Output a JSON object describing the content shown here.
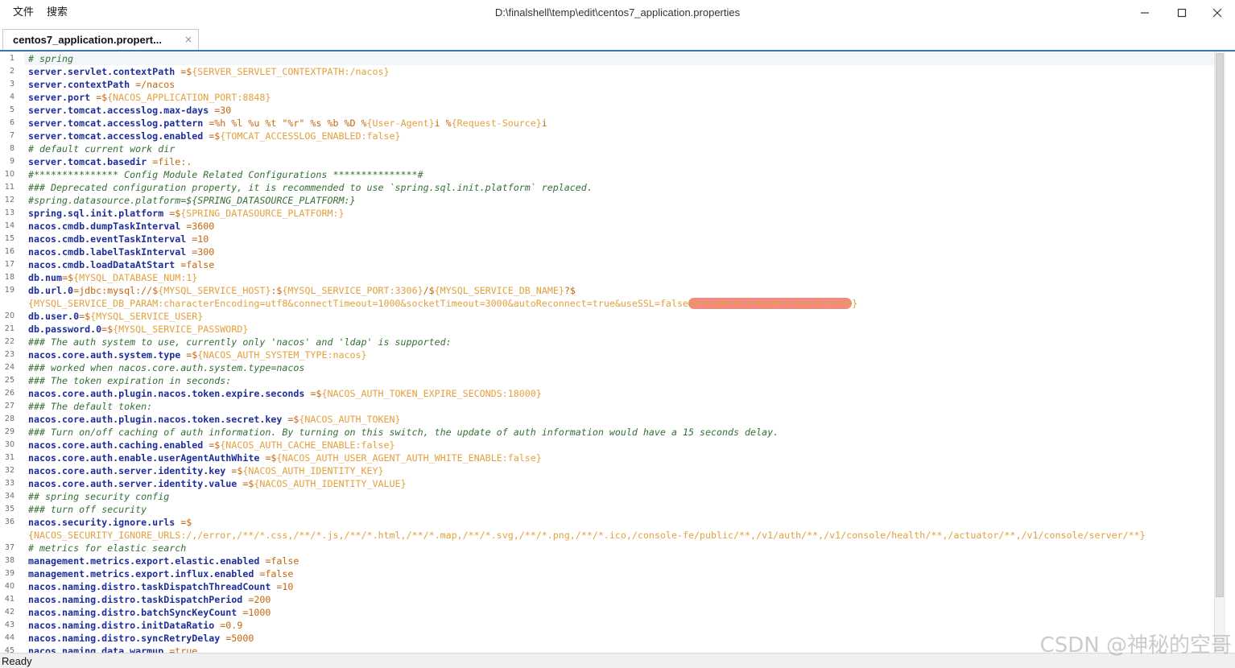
{
  "window": {
    "menu": [
      {
        "label": "文件"
      },
      {
        "label": "搜索"
      }
    ],
    "title": "D:\\finalshell\\temp\\edit\\centos7_application.properties",
    "icons": {
      "minimize": "minimize-icon",
      "maximize": "maximize-icon",
      "close": "close-icon"
    }
  },
  "tabs": [
    {
      "label": "centos7_application.propert...",
      "close": "×"
    }
  ],
  "editor": {
    "current_line": 1,
    "lines": [
      {
        "n": "1",
        "rows": [
          [
            {
              "comment": "# spring"
            }
          ]
        ]
      },
      {
        "n": "2",
        "rows": [
          [
            {
              "key": "server.servlet.contextPath"
            },
            {
              "val": " =$"
            },
            {
              "var": "{SERVER_SERVLET_CONTEXTPATH:/nacos}"
            }
          ]
        ]
      },
      {
        "n": "3",
        "rows": [
          [
            {
              "key": "server.contextPath"
            },
            {
              "val": " =/nacos"
            }
          ]
        ]
      },
      {
        "n": "4",
        "rows": [
          [
            {
              "key": "server.port"
            },
            {
              "val": " =$"
            },
            {
              "var": "{NACOS_APPLICATION_PORT:8848}"
            }
          ]
        ]
      },
      {
        "n": "5",
        "rows": [
          [
            {
              "key": "server.tomcat.accesslog.max-days"
            },
            {
              "val": " =30"
            }
          ]
        ]
      },
      {
        "n": "6",
        "rows": [
          [
            {
              "key": "server.tomcat.accesslog.pattern"
            },
            {
              "val": " =%h %l %u %t \"%r\" %s %b %D %"
            },
            {
              "var": "{User-Agent}"
            },
            {
              "val": "i %"
            },
            {
              "var": "{Request-Source}"
            },
            {
              "val": "i"
            }
          ]
        ]
      },
      {
        "n": "7",
        "rows": [
          [
            {
              "key": "server.tomcat.accesslog.enabled"
            },
            {
              "val": " =$"
            },
            {
              "var": "{TOMCAT_ACCESSLOG_ENABLED:false}"
            }
          ]
        ]
      },
      {
        "n": "8",
        "rows": [
          [
            {
              "comment": "# default current work dir"
            }
          ]
        ]
      },
      {
        "n": "9",
        "rows": [
          [
            {
              "key": "server.tomcat.basedir"
            },
            {
              "val": " =file:."
            }
          ]
        ]
      },
      {
        "n": "10",
        "rows": [
          [
            {
              "comment": "#*************** Config Module Related Configurations ***************#"
            }
          ]
        ]
      },
      {
        "n": "11",
        "rows": [
          [
            {
              "comment": "### Deprecated configuration property, it is recommended to use `spring.sql.init.platform` replaced."
            }
          ]
        ]
      },
      {
        "n": "12",
        "rows": [
          [
            {
              "comment": "#spring.datasource.platform=${SPRING_DATASOURCE_PLATFORM:}"
            }
          ]
        ]
      },
      {
        "n": "13",
        "rows": [
          [
            {
              "key": "spring.sql.init.platform"
            },
            {
              "val": " =$"
            },
            {
              "var": "{SPRING_DATASOURCE_PLATFORM:}"
            }
          ]
        ]
      },
      {
        "n": "14",
        "rows": [
          [
            {
              "key": "nacos.cmdb.dumpTaskInterval"
            },
            {
              "val": " =3600"
            }
          ]
        ]
      },
      {
        "n": "15",
        "rows": [
          [
            {
              "key": "nacos.cmdb.eventTaskInterval"
            },
            {
              "val": " =10"
            }
          ]
        ]
      },
      {
        "n": "16",
        "rows": [
          [
            {
              "key": "nacos.cmdb.labelTaskInterval"
            },
            {
              "val": " =300"
            }
          ]
        ]
      },
      {
        "n": "17",
        "rows": [
          [
            {
              "key": "nacos.cmdb.loadDataAtStart"
            },
            {
              "val": " =false"
            }
          ]
        ]
      },
      {
        "n": "18",
        "rows": [
          [
            {
              "key": "db.num"
            },
            {
              "val": "=$"
            },
            {
              "var": "{MYSQL_DATABASE_NUM:1}"
            }
          ]
        ]
      },
      {
        "n": "19",
        "rows": [
          [
            {
              "key": "db.url.0"
            },
            {
              "val": "=jdbc:mysql://$"
            },
            {
              "var": "{MYSQL_SERVICE_HOST}"
            },
            {
              "val": ":$"
            },
            {
              "var": "{MYSQL_SERVICE_PORT:3306}"
            },
            {
              "val": "/$"
            },
            {
              "var": "{MYSQL_SERVICE_DB_NAME}"
            },
            {
              "val": "?$"
            }
          ],
          [
            {
              "var": "{MYSQL_SERVICE_DB_PARAM:characterEncoding=utf8&connectTimeout=1000&socketTimeout=3000&autoReconnect=true&useSSL=false"
            },
            {
              "mark": "&allowPublicKeyRetrieval=true"
            },
            {
              "var": "}"
            }
          ]
        ]
      },
      {
        "n": "20",
        "rows": [
          [
            {
              "key": "db.user.0"
            },
            {
              "val": "=$"
            },
            {
              "var": "{MYSQL_SERVICE_USER}"
            }
          ]
        ]
      },
      {
        "n": "21",
        "rows": [
          [
            {
              "key": "db.password.0"
            },
            {
              "val": "=$"
            },
            {
              "var": "{MYSQL_SERVICE_PASSWORD}"
            }
          ]
        ]
      },
      {
        "n": "22",
        "rows": [
          [
            {
              "comment": "### The auth system to use, currently only 'nacos' and 'ldap' is supported:"
            }
          ]
        ]
      },
      {
        "n": "23",
        "rows": [
          [
            {
              "key": "nacos.core.auth.system.type"
            },
            {
              "val": " =$"
            },
            {
              "var": "{NACOS_AUTH_SYSTEM_TYPE:nacos}"
            }
          ]
        ]
      },
      {
        "n": "24",
        "rows": [
          [
            {
              "comment": "### worked when nacos.core.auth.system.type=nacos"
            }
          ]
        ]
      },
      {
        "n": "25",
        "rows": [
          [
            {
              "comment": "### The token expiration in seconds:"
            }
          ]
        ]
      },
      {
        "n": "26",
        "rows": [
          [
            {
              "key": "nacos.core.auth.plugin.nacos.token.expire.seconds"
            },
            {
              "val": " =$"
            },
            {
              "var": "{NACOS_AUTH_TOKEN_EXPIRE_SECONDS:18000}"
            }
          ]
        ]
      },
      {
        "n": "27",
        "rows": [
          [
            {
              "comment": "### The default token:"
            }
          ]
        ]
      },
      {
        "n": "28",
        "rows": [
          [
            {
              "key": "nacos.core.auth.plugin.nacos.token.secret.key"
            },
            {
              "val": " =$"
            },
            {
              "var": "{NACOS_AUTH_TOKEN}"
            }
          ]
        ]
      },
      {
        "n": "29",
        "rows": [
          [
            {
              "comment": "### Turn on/off caching of auth information. By turning on this switch, the update of auth information would have a 15 seconds delay."
            }
          ]
        ]
      },
      {
        "n": "30",
        "rows": [
          [
            {
              "key": "nacos.core.auth.caching.enabled"
            },
            {
              "val": " =$"
            },
            {
              "var": "{NACOS_AUTH_CACHE_ENABLE:false}"
            }
          ]
        ]
      },
      {
        "n": "31",
        "rows": [
          [
            {
              "key": "nacos.core.auth.enable.userAgentAuthWhite"
            },
            {
              "val": " =$"
            },
            {
              "var": "{NACOS_AUTH_USER_AGENT_AUTH_WHITE_ENABLE:false}"
            }
          ]
        ]
      },
      {
        "n": "32",
        "rows": [
          [
            {
              "key": "nacos.core.auth.server.identity.key"
            },
            {
              "val": " =$"
            },
            {
              "var": "{NACOS_AUTH_IDENTITY_KEY}"
            }
          ]
        ]
      },
      {
        "n": "33",
        "rows": [
          [
            {
              "key": "nacos.core.auth.server.identity.value"
            },
            {
              "val": " =$"
            },
            {
              "var": "{NACOS_AUTH_IDENTITY_VALUE}"
            }
          ]
        ]
      },
      {
        "n": "34",
        "rows": [
          [
            {
              "comment": "## spring security config"
            }
          ]
        ]
      },
      {
        "n": "35",
        "rows": [
          [
            {
              "comment": "### turn off security"
            }
          ]
        ]
      },
      {
        "n": "36",
        "rows": [
          [
            {
              "key": "nacos.security.ignore.urls"
            },
            {
              "val": " =$"
            }
          ],
          [
            {
              "var": "{NACOS_SECURITY_IGNORE_URLS:/,/error,/**/*.css,/**/*.js,/**/*.html,/**/*.map,/**/*.svg,/**/*.png,/**/*.ico,/console-fe/public/**,/v1/auth/**,/v1/console/health/**,/actuator/**,/v1/console/server/**}"
            }
          ]
        ]
      },
      {
        "n": "37",
        "rows": [
          [
            {
              "comment": "# metrics for elastic search"
            }
          ]
        ]
      },
      {
        "n": "38",
        "rows": [
          [
            {
              "key": "management.metrics.export.elastic.enabled"
            },
            {
              "val": " =false"
            }
          ]
        ]
      },
      {
        "n": "39",
        "rows": [
          [
            {
              "key": "management.metrics.export.influx.enabled"
            },
            {
              "val": " =false"
            }
          ]
        ]
      },
      {
        "n": "40",
        "rows": [
          [
            {
              "key": "nacos.naming.distro.taskDispatchThreadCount"
            },
            {
              "val": " =10"
            }
          ]
        ]
      },
      {
        "n": "41",
        "rows": [
          [
            {
              "key": "nacos.naming.distro.taskDispatchPeriod"
            },
            {
              "val": " =200"
            }
          ]
        ]
      },
      {
        "n": "42",
        "rows": [
          [
            {
              "key": "nacos.naming.distro.batchSyncKeyCount"
            },
            {
              "val": " =1000"
            }
          ]
        ]
      },
      {
        "n": "43",
        "rows": [
          [
            {
              "key": "nacos.naming.distro.initDataRatio"
            },
            {
              "val": " =0.9"
            }
          ]
        ]
      },
      {
        "n": "44",
        "rows": [
          [
            {
              "key": "nacos.naming.distro.syncRetryDelay"
            },
            {
              "val": " =5000"
            }
          ]
        ]
      },
      {
        "n": "45",
        "rows": [
          [
            {
              "key": "nacos.naming.data.warmup"
            },
            {
              "val": " =true"
            }
          ]
        ]
      }
    ]
  },
  "scrollbar": {
    "position": 0,
    "visible_fraction": 0.91
  },
  "status": {
    "text": "Ready"
  },
  "watermark": "CSDN @神秘的空哥",
  "colors": {
    "comment": "#356f35",
    "key": "#1f2d9a",
    "val": "#c4660c",
    "var": "#e3a03c",
    "mark": "#f28b86",
    "line_number": "#6e6e6e",
    "current_line": "#f2f5fa",
    "accent": "#3b73b9"
  }
}
